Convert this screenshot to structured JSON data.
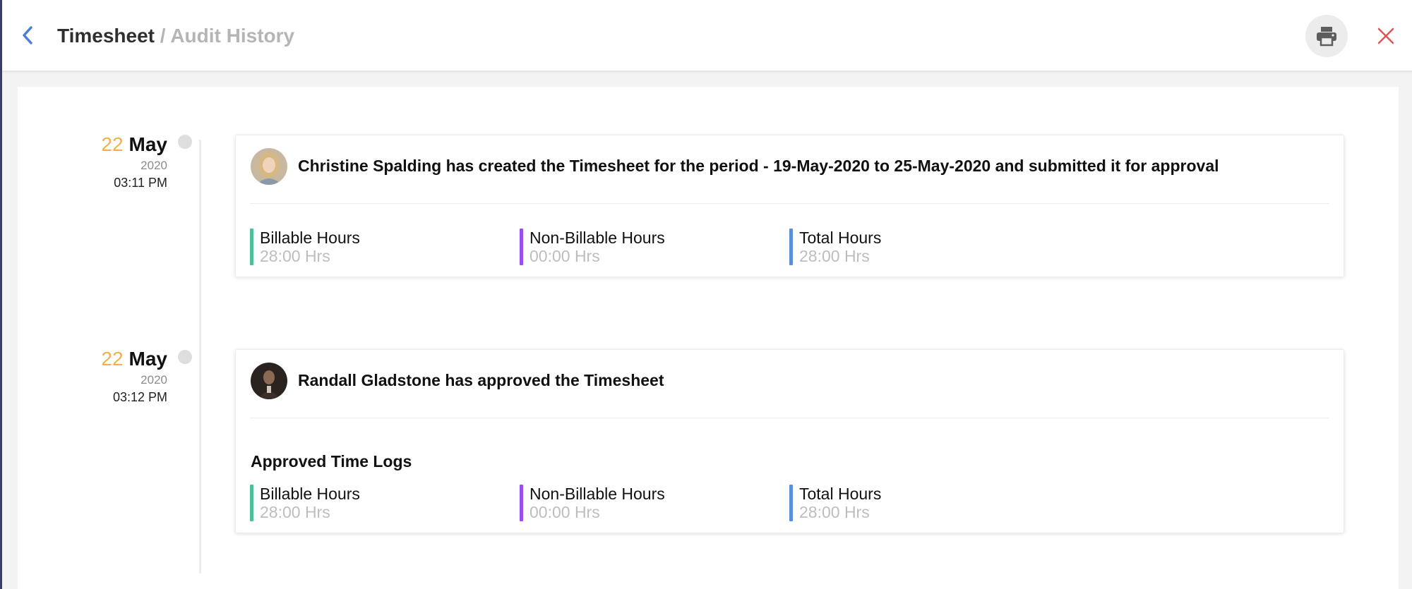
{
  "header": {
    "title": "Timesheet",
    "separator": "/",
    "subtitle": "Audit History",
    "back_icon": "chevron-left-icon",
    "print_icon": "printer-icon",
    "close_icon": "close-icon"
  },
  "colors": {
    "billable": "#4fbf99",
    "non_billable": "#9a4df0",
    "total": "#5a8fd8",
    "date_day": "#f0b34a",
    "back_icon": "#4a7fd4",
    "close_icon": "#e05555"
  },
  "entries": [
    {
      "day": "22",
      "month": "May",
      "year": "2020",
      "time": "03:11 PM",
      "avatar": "avatar-christine",
      "message": "Christine Spalding has created the Timesheet for the period - 19-May-2020 to 25-May-2020 and submitted it for approval",
      "section_title": "",
      "stats": [
        {
          "label": "Billable Hours",
          "value": "28:00 Hrs"
        },
        {
          "label": "Non-Billable Hours",
          "value": "00:00 Hrs"
        },
        {
          "label": "Total Hours",
          "value": "28:00 Hrs"
        }
      ]
    },
    {
      "day": "22",
      "month": "May",
      "year": "2020",
      "time": "03:12 PM",
      "avatar": "avatar-randall",
      "message": "Randall Gladstone has approved the Timesheet",
      "section_title": "Approved Time Logs",
      "stats": [
        {
          "label": "Billable Hours",
          "value": "28:00 Hrs"
        },
        {
          "label": "Non-Billable Hours",
          "value": "00:00 Hrs"
        },
        {
          "label": "Total Hours",
          "value": "28:00 Hrs"
        }
      ]
    }
  ]
}
